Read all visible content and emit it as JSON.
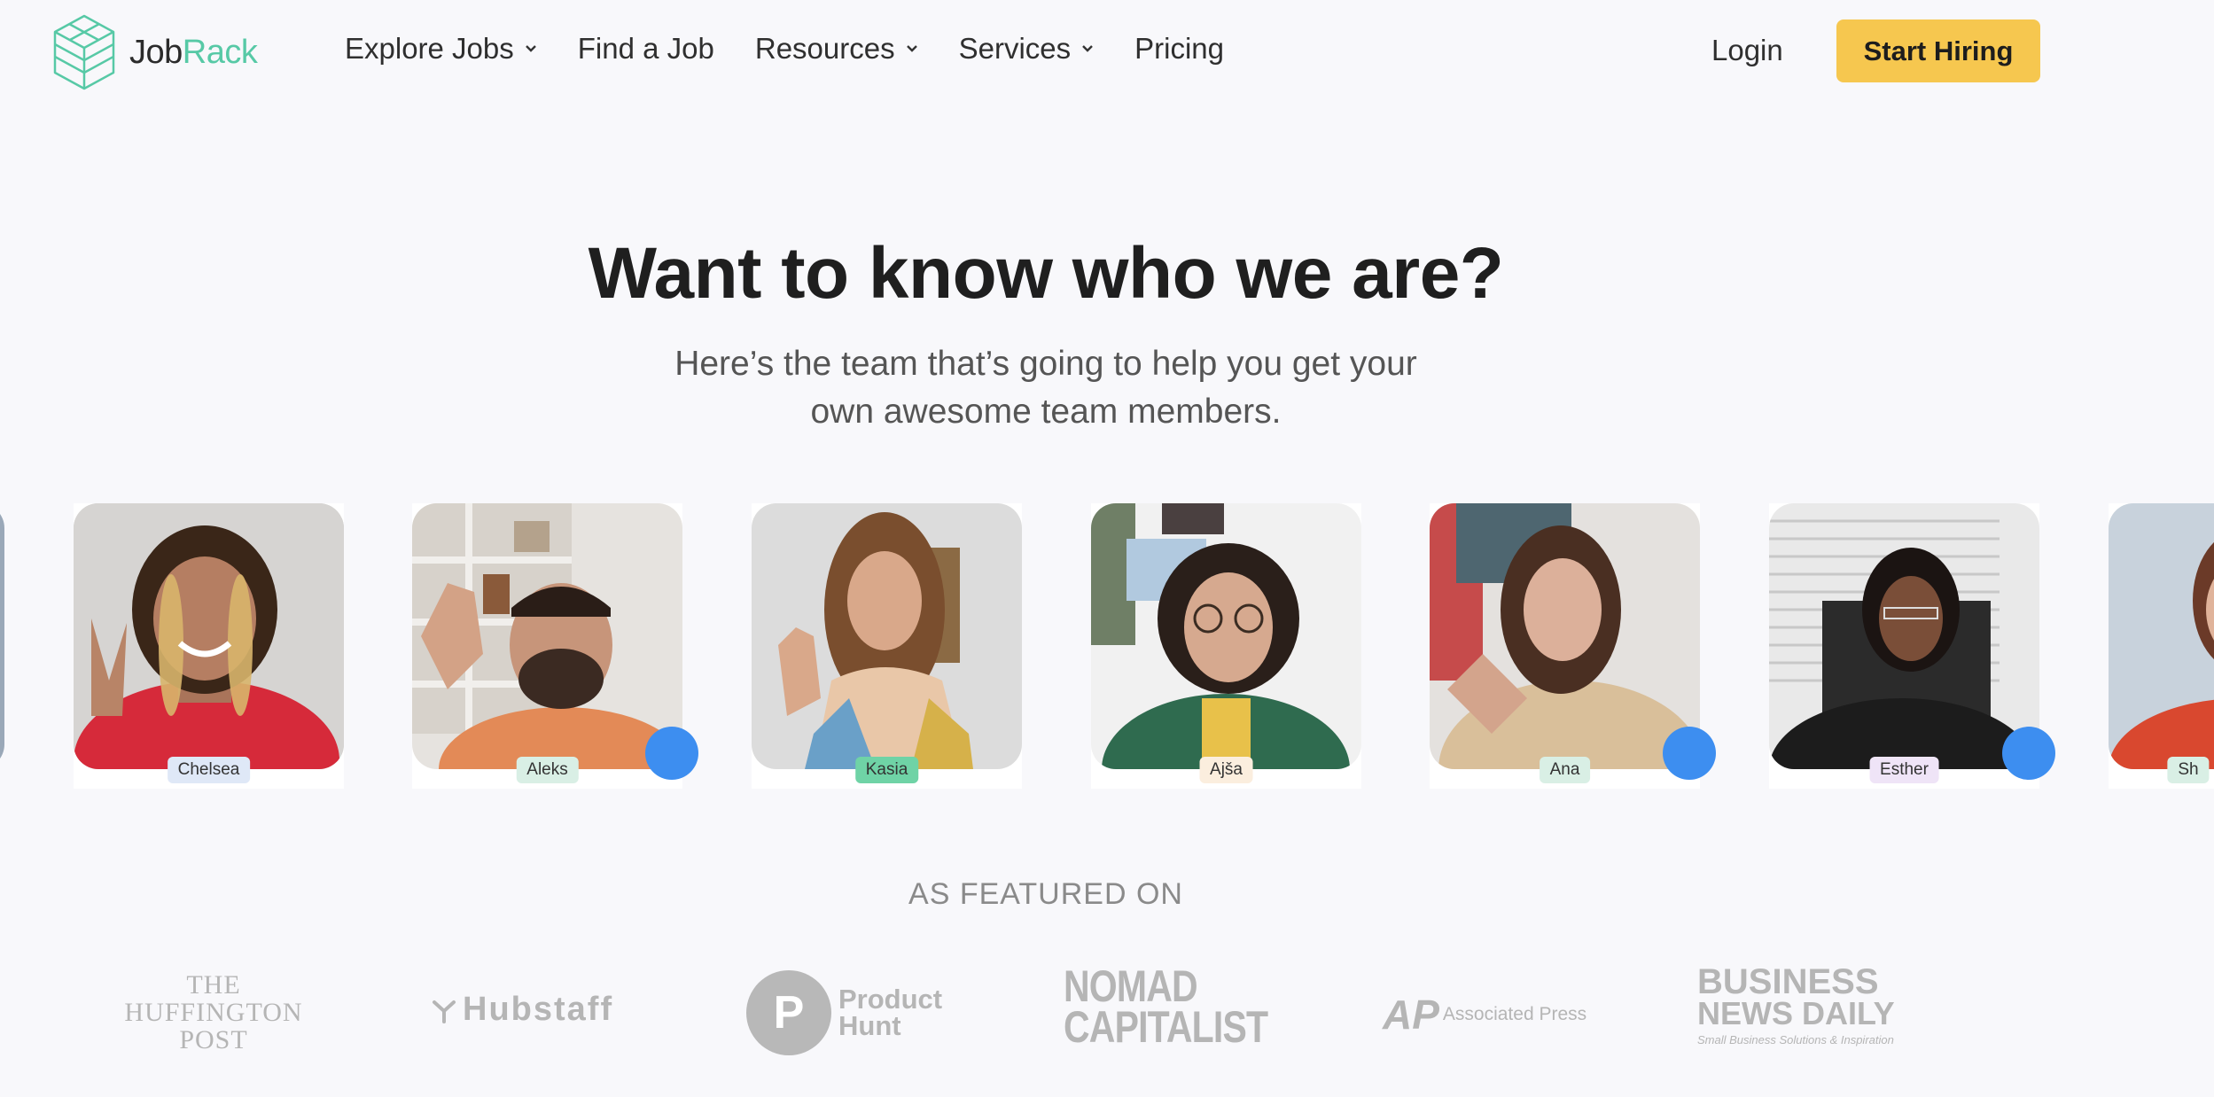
{
  "nav": {
    "brand_part1": "Job",
    "brand_part2": "Rack",
    "links": [
      {
        "label": "Explore Jobs",
        "dropdown": true
      },
      {
        "label": "Find a Job",
        "dropdown": false
      },
      {
        "label": "Resources",
        "dropdown": true
      },
      {
        "label": "Services",
        "dropdown": true
      },
      {
        "label": "Pricing",
        "dropdown": false
      }
    ],
    "login": "Login",
    "cta": "Start Hiring"
  },
  "hero": {
    "title": "Want to know who we are?",
    "subtitle_line1": "Here’s the team that’s going to help you get your",
    "subtitle_line2": "own awesome team members."
  },
  "team": [
    {
      "name": "Chelsea",
      "tag_color": "#dfe8f7"
    },
    {
      "name": "Aleks",
      "tag_color": "#d9efe5"
    },
    {
      "name": "Kasia",
      "tag_color": "#6fd3a6"
    },
    {
      "name": "Ajša",
      "tag_color": "#fbeede"
    },
    {
      "name": "Ana",
      "tag_color": "#d9efe5"
    },
    {
      "name": "Esther",
      "tag_color": "#efe4f7"
    },
    {
      "name": "Sh",
      "tag_color": "#d9efe5"
    }
  ],
  "featured": {
    "title": "AS FEATURED ON",
    "huffington": [
      "THE",
      "HUFFINGTON",
      "POST"
    ],
    "hubstaff": "Hubstaff",
    "producthunt_letter": "P",
    "producthunt": [
      "Product",
      "Hunt"
    ],
    "nomad": [
      "NOMAD",
      "CAPITALIST"
    ],
    "ap_mark": "AP",
    "ap_text": "Associated Press",
    "bnd": [
      "BUSINESS",
      "NEWS DAILY",
      "Small Business Solutions & Inspiration"
    ]
  },
  "colors": {
    "accent_yellow": "#f6c74f",
    "brand_green": "#57c9a6",
    "background": "#f8f8fb"
  }
}
